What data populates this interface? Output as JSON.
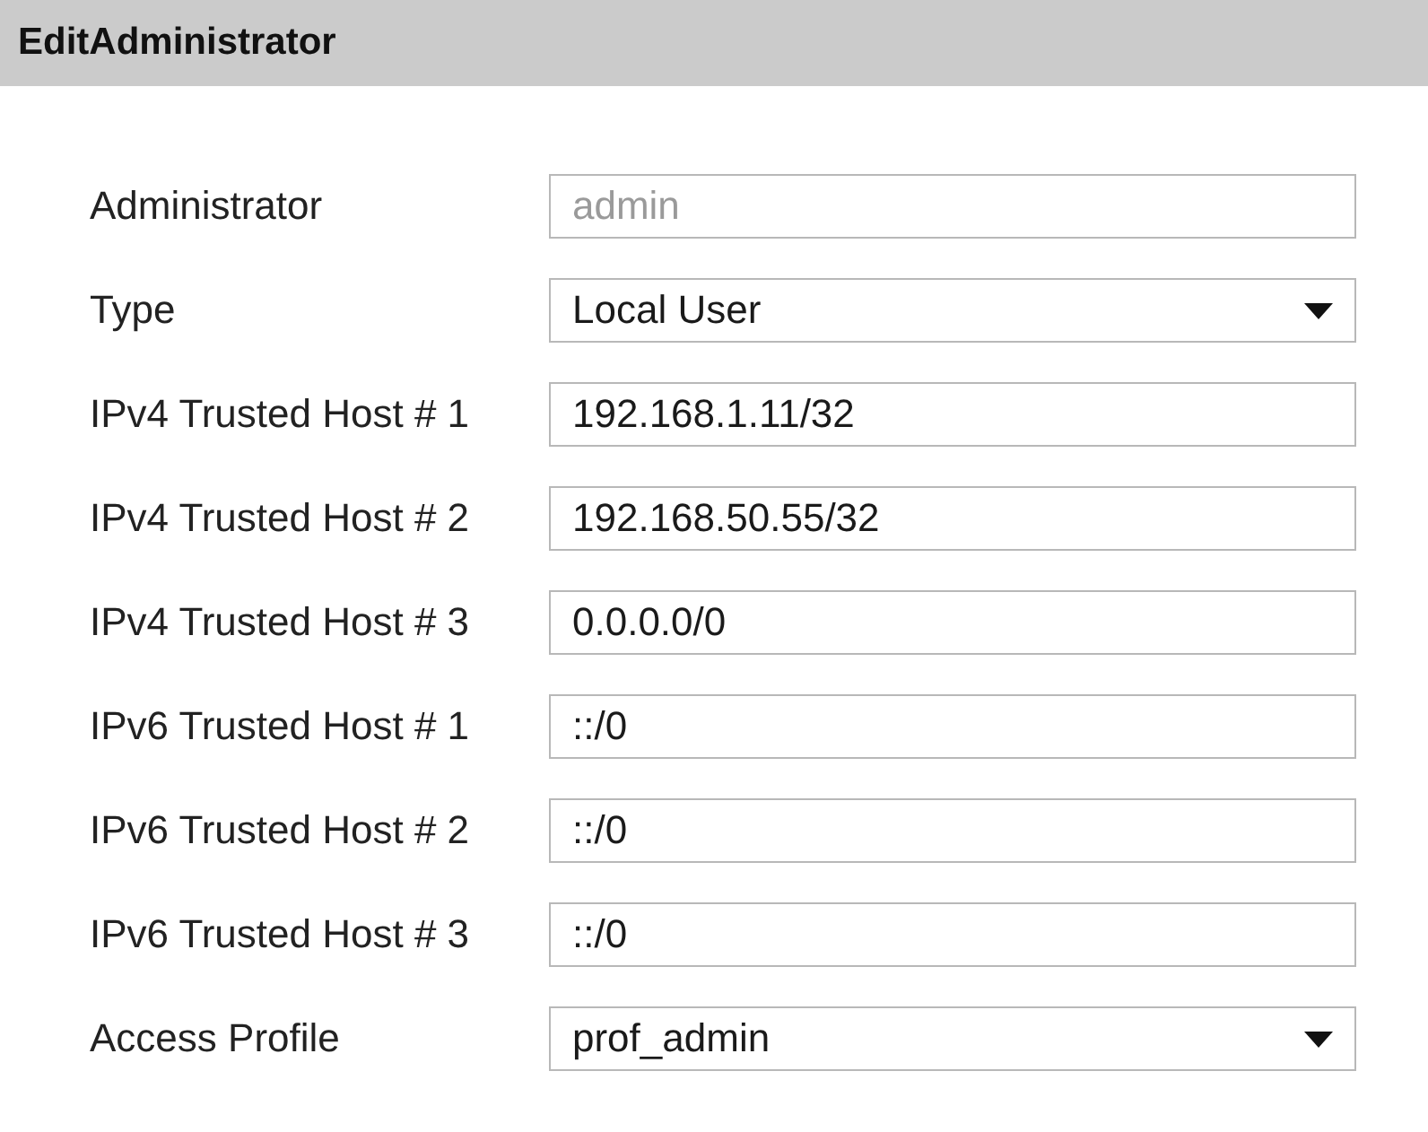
{
  "dialog": {
    "title": "EditAdministrator"
  },
  "fields": [
    {
      "label": "Administrator",
      "kind": "text",
      "value": "admin",
      "disabled": true
    },
    {
      "label": "Type",
      "kind": "select",
      "value": "Local User",
      "disabled": false
    },
    {
      "label": "IPv4 Trusted Host # 1",
      "kind": "text",
      "value": "192.168.1.11/32",
      "disabled": false
    },
    {
      "label": "IPv4 Trusted Host # 2",
      "kind": "text",
      "value": "192.168.50.55/32",
      "disabled": false
    },
    {
      "label": "IPv4 Trusted Host # 3",
      "kind": "text",
      "value": "0.0.0.0/0",
      "disabled": false
    },
    {
      "label": "IPv6 Trusted Host # 1",
      "kind": "text",
      "value": "::/0",
      "disabled": false
    },
    {
      "label": "IPv6 Trusted Host # 2",
      "kind": "text",
      "value": "::/0",
      "disabled": false
    },
    {
      "label": "IPv6 Trusted Host # 3",
      "kind": "text",
      "value": "::/0",
      "disabled": false
    },
    {
      "label": "Access Profile",
      "kind": "select",
      "value": "prof_admin",
      "disabled": false
    }
  ]
}
